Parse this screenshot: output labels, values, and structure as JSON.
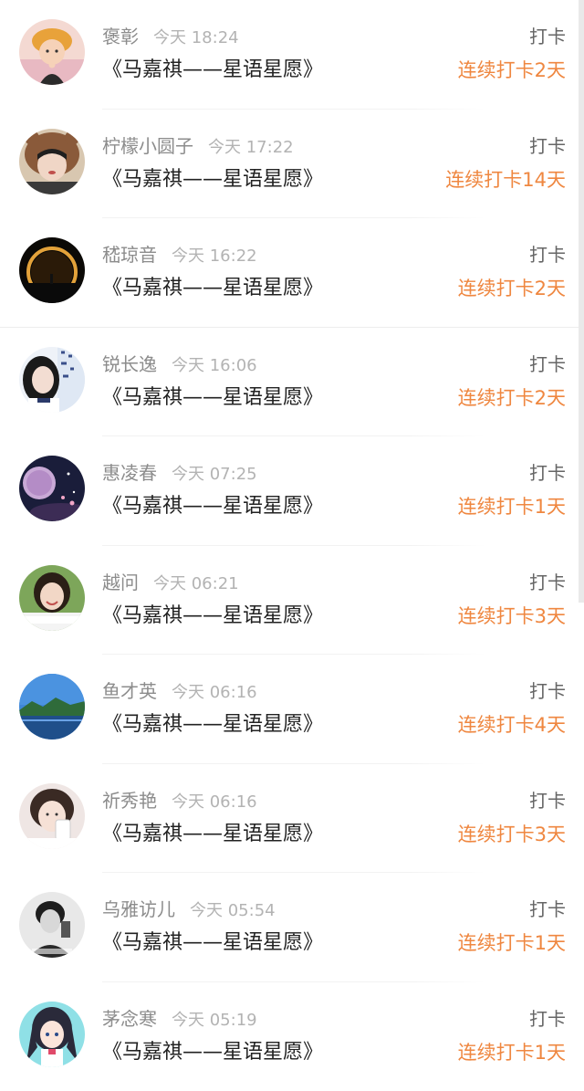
{
  "colors": {
    "streak": "#ef8740",
    "name": "#8c8c8c",
    "time": "#b3b3b3",
    "title": "#222222",
    "action": "#666666"
  },
  "entries": [
    {
      "name": "褒彰",
      "time": "今天 18:24",
      "action": "打卡",
      "title": "《马嘉祺——星语星愿》",
      "streak": "连续打卡2天",
      "avatar": "avatar-child-hat"
    },
    {
      "name": "柠檬小圆子",
      "time": "今天 17:22",
      "action": "打卡",
      "title": "《马嘉祺——星语星愿》",
      "streak": "连续打卡14天",
      "avatar": "avatar-bear-hood"
    },
    {
      "name": "嵇琼音",
      "time": "今天 16:22",
      "action": "打卡",
      "title": "《马嘉祺——星语星愿》",
      "streak": "连续打卡2天",
      "avatar": "avatar-eclipse"
    },
    {
      "name": "锐长逸",
      "time": "今天 16:06",
      "action": "打卡",
      "title": "《马嘉祺——星语星愿》",
      "streak": "连续打卡2天",
      "avatar": "avatar-girl-calligraphy"
    },
    {
      "name": "惠凌春",
      "time": "今天 07:25",
      "action": "打卡",
      "title": "《马嘉祺——星语星愿》",
      "streak": "连续打卡1天",
      "avatar": "avatar-night-moon"
    },
    {
      "name": "越问",
      "time": "今天 06:21",
      "action": "打卡",
      "title": "《马嘉祺——星语星愿》",
      "streak": "连续打卡3天",
      "avatar": "avatar-girl-green"
    },
    {
      "name": "鱼才英",
      "time": "今天 06:16",
      "action": "打卡",
      "title": "《马嘉祺——星语星愿》",
      "streak": "连续打卡4天",
      "avatar": "avatar-lake-mountains"
    },
    {
      "name": "祈秀艳",
      "time": "今天 06:16",
      "action": "打卡",
      "title": "《马嘉祺——星语星愿》",
      "streak": "连续打卡3天",
      "avatar": "avatar-girl-phone"
    },
    {
      "name": "乌雅访儿",
      "time": "今天 05:54",
      "action": "打卡",
      "title": "《马嘉祺——星语星愿》",
      "streak": "连续打卡1天",
      "avatar": "avatar-bw-boy"
    },
    {
      "name": "茅念寒",
      "time": "今天 05:19",
      "action": "打卡",
      "title": "《马嘉祺——星语星愿》",
      "streak": "连续打卡1天",
      "avatar": "avatar-anime-girl"
    }
  ]
}
